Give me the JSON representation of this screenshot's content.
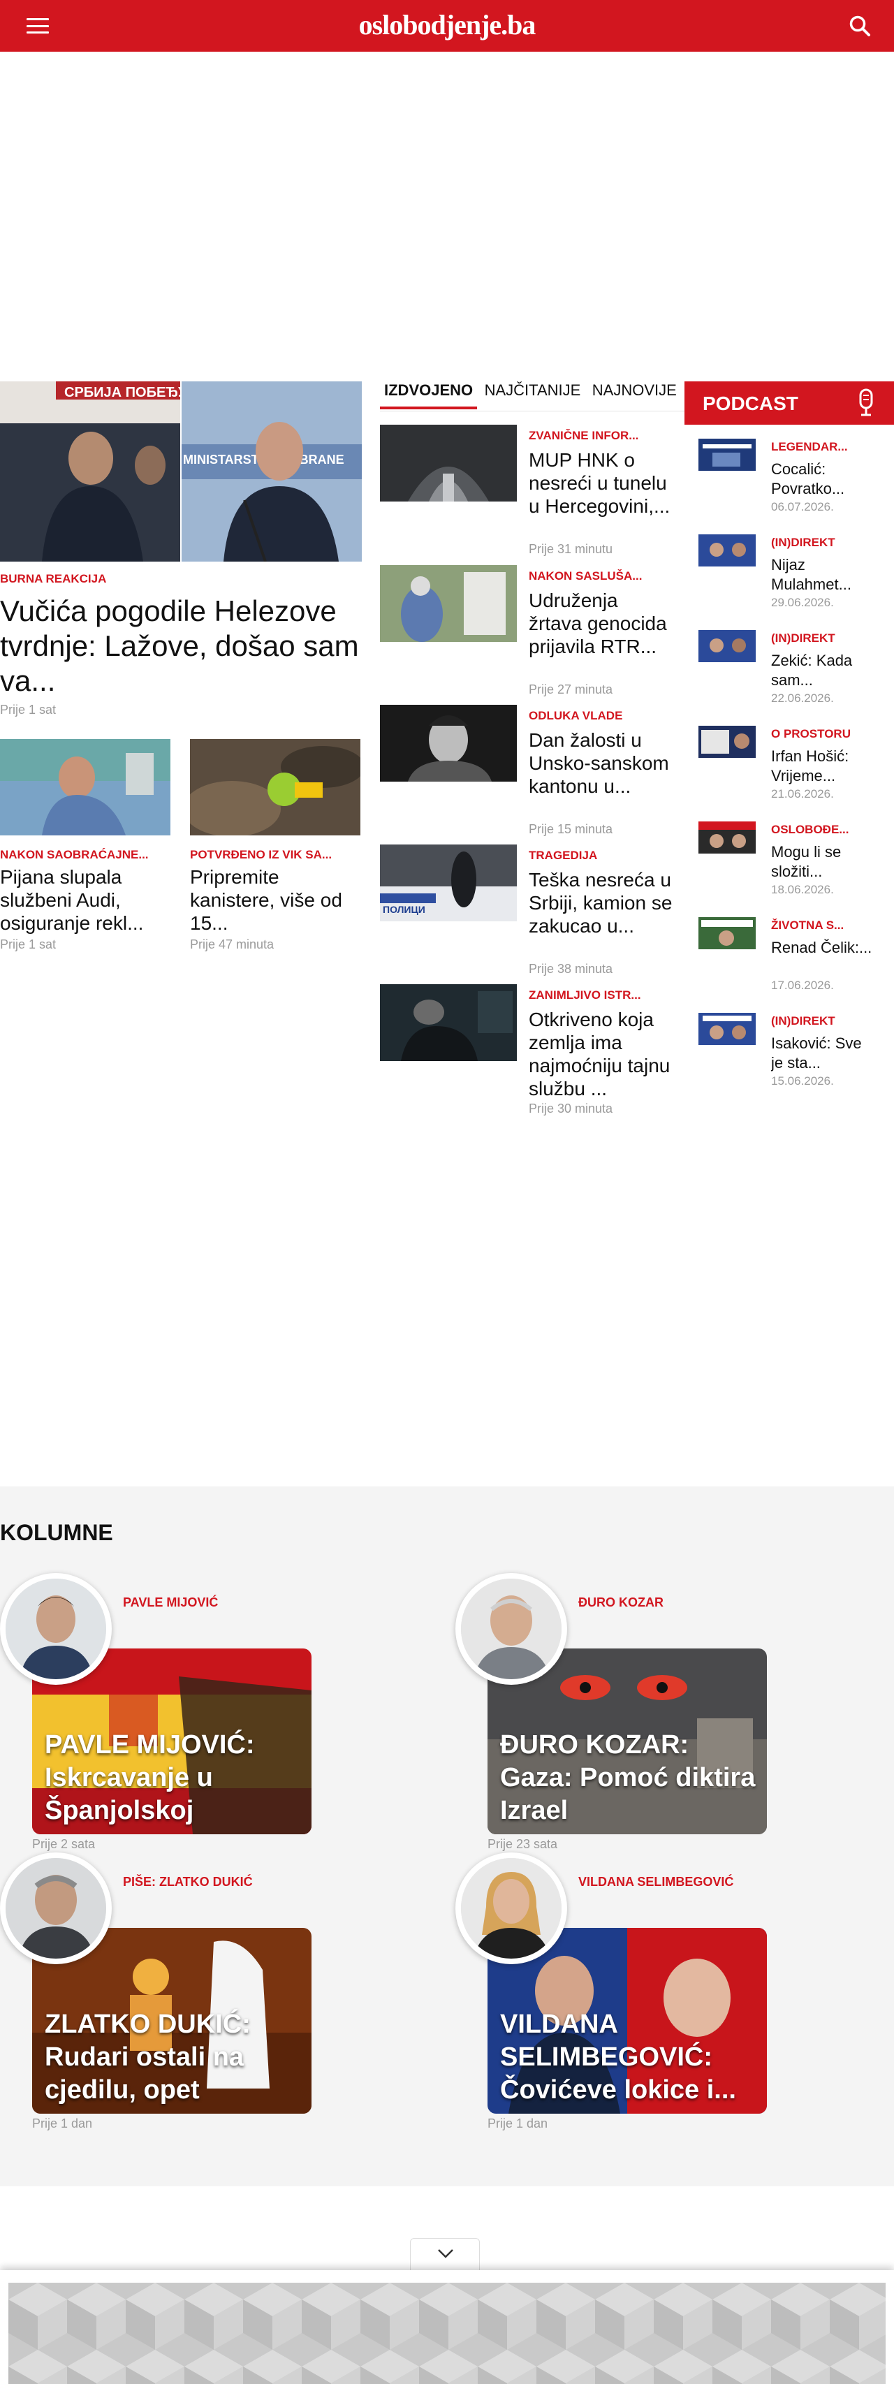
{
  "header": {
    "logo": "oslobodjenje.ba"
  },
  "featured": {
    "category": "BURNA REAKCIJA",
    "title": "Vučića pogodile Helezove tvrdnje: Lažove, došao sam va...",
    "time": "Prije 1 sat",
    "image_left_text": "СРБИЈА ПОБЕЂУЈЕ",
    "image_right_text": "MINISTARSTVO ODBRANE"
  },
  "small_cards": [
    {
      "category": "NAKON SAOBRAĆAJNE...",
      "title": "Pijana slupala službeni Audi, osiguranje rekl...",
      "time": "Prije 1 sat"
    },
    {
      "category": "POTVRĐENO IZ VIK SA...",
      "title": "Pripremite kanistere, više od 15...",
      "time": "Prije 47 minuta"
    }
  ],
  "tabs": [
    "IZDVOJENO",
    "NAJČITANIJE",
    "NAJNOVIJE"
  ],
  "list": [
    {
      "category": "ZVANIČNE INFOR...",
      "title": "MUP HNK o nesreći u tunelu u Hercegovini,...",
      "time": "Prije 31 minutu"
    },
    {
      "category": "NAKON SASLUŠA...",
      "title": "Udruženja žrtava genocida prijavila RTR...",
      "time": "Prije 27 minuta"
    },
    {
      "category": "ODLUKA VLADE",
      "title": "Dan žalosti u Unsko-sanskom kantonu u...",
      "time": "Prije 15 minuta"
    },
    {
      "category": "TRAGEDIJA",
      "title": "Teška nesreća u Srbiji, kamion se zakucao u...",
      "time": "Prije 38 minuta",
      "image_text": "ПОЛИЦИ"
    },
    {
      "category": "ZANIMLJIVO ISTR...",
      "title": "Otkriveno koja zemlja ima najmoćniju tajnu službu ...",
      "time": "Prije 30 minuta"
    }
  ],
  "podcast": {
    "label": "PODCAST",
    "items": [
      {
        "category": "LEGENDAR...",
        "title": "Cocalić: Povratko...",
        "date": "06.07.2026."
      },
      {
        "category": "(IN)DIREKT",
        "title": "Nijaz Mulahmet...",
        "date": "29.06.2026."
      },
      {
        "category": "(IN)DIREKT",
        "title": "Zekić: Kada sam...",
        "date": "22.06.2026."
      },
      {
        "category": "O PROSTORU",
        "title": "Irfan Hošić: Vrijeme...",
        "date": "21.06.2026."
      },
      {
        "category": "OSLOBOĐE...",
        "title": "Mogu li se složiti...",
        "date": "18.06.2026."
      },
      {
        "category": "ŽIVOTNA S...",
        "title": "Renad Čelik:...",
        "date": "17.06.2026."
      },
      {
        "category": "(IN)DIREKT",
        "title": "Isaković: Sve je sta...",
        "date": "15.06.2026."
      }
    ]
  },
  "columns": {
    "title": "KOLUMNE",
    "items": [
      {
        "author": "PAVLE MIJOVIĆ",
        "title": "PAVLE MIJOVIĆ: Iskrcavanje u Španjolskoj",
        "time": "Prije 2 sata"
      },
      {
        "author": "ĐURO KOZAR",
        "title": "ĐURO KOZAR: Gaza: Pomoć diktira Izrael",
        "time": "Prije 23 sata"
      },
      {
        "author": "PIŠE: ZLATKO DUKIĆ",
        "title": "ZLATKO DUKIĆ: Rudari ostali na cjedilu, opet",
        "time": "Prije 1 dan"
      },
      {
        "author": "VILDANA SELIMBEGOVIĆ",
        "title": "VILDANA SELIMBEGOVIĆ: Čovićeve lokice i...",
        "time": "Prije 1 dan"
      }
    ]
  },
  "colors": {
    "brand": "#d2161f",
    "meta": "#9a9a9a",
    "section_bg": "#f4f4f4"
  },
  "icons": [
    "menu-icon",
    "search-icon",
    "microphone-icon",
    "chevron-down-icon"
  ]
}
